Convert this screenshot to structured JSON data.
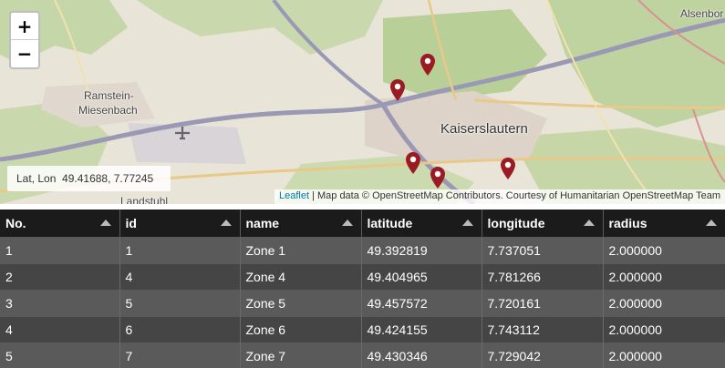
{
  "map": {
    "zoom_in_label": "+",
    "zoom_out_label": "−",
    "coords_text": "Lat, Lon  49.41688, 7.77245",
    "attribution": {
      "leaflet": "Leaflet",
      "rest": " | Map data © OpenStreetMap Contributors. Courtesy of Humanitarian OpenStreetMap Team"
    },
    "place_labels": {
      "ramstein_1": "Ramstein-",
      "ramstein_2": "Miesenbach",
      "kaiserslautern": "Kaiserslautern",
      "alsenborn": "Alsenbor",
      "landstuhl": "Landstuhl"
    },
    "marker_color": "#9b1b22"
  },
  "table": {
    "columns": [
      "No.",
      "id",
      "name",
      "latitude",
      "longitude",
      "radius"
    ],
    "rows": [
      [
        "1",
        "1",
        "Zone 1",
        "49.392819",
        "7.737051",
        "2.000000"
      ],
      [
        "2",
        "4",
        "Zone 4",
        "49.404965",
        "7.781266",
        "2.000000"
      ],
      [
        "3",
        "5",
        "Zone 5",
        "49.457572",
        "7.720161",
        "2.000000"
      ],
      [
        "4",
        "6",
        "Zone 6",
        "49.424155",
        "7.743112",
        "2.000000"
      ],
      [
        "5",
        "7",
        "Zone 7",
        "49.430346",
        "7.729042",
        "2.000000"
      ]
    ]
  }
}
